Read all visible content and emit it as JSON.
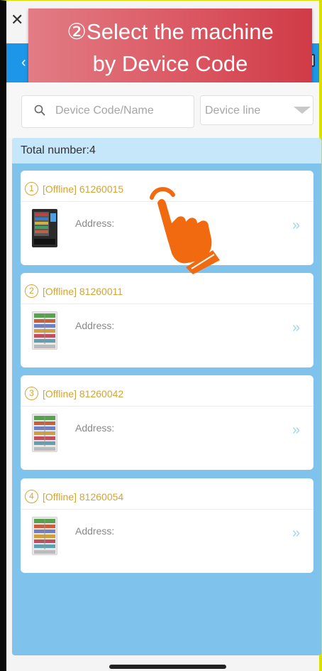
{
  "banner": {
    "line1": "②Select the machine",
    "line2": "by Device Code"
  },
  "search": {
    "placeholder": "Device Code/Name"
  },
  "filter": {
    "label": "Device line"
  },
  "list": {
    "total": "Total number:4",
    "items": [
      {
        "index": "1",
        "status": "[Offline]",
        "code": "61260015",
        "address_label": "Address:"
      },
      {
        "index": "2",
        "status": "[Offline]",
        "code": "81260011",
        "address_label": "Address:"
      },
      {
        "index": "3",
        "status": "[Offline]",
        "code": "81260042",
        "address_label": "Address:"
      },
      {
        "index": "4",
        "status": "[Offline]",
        "code": "81260054",
        "address_label": "Address:"
      }
    ]
  },
  "icons": {
    "close": "close-icon",
    "search": "search-icon",
    "chevron": "double-chevron-right-icon",
    "hand": "hand-pointer-icon"
  },
  "colors": {
    "accent": "#1e96e8",
    "status": "#d4a532",
    "banner": "#da5560",
    "hand": "#f26a10"
  }
}
